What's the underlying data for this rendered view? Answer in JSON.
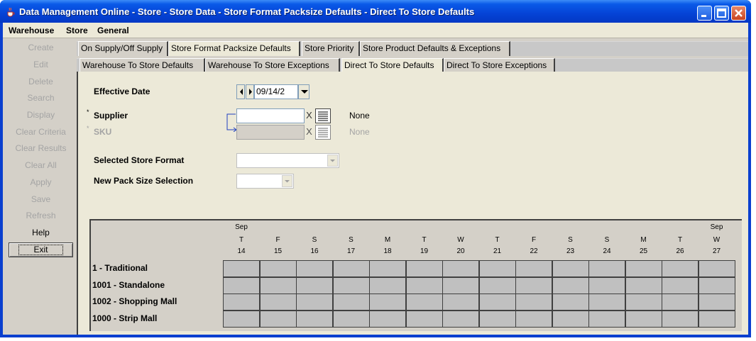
{
  "window": {
    "title": "Data Management Online - Store - Store Data - Store Format Packsize Defaults - Direct To Store Defaults",
    "icon": "java-cup-icon"
  },
  "menu": [
    "Warehouse",
    "Store",
    "General"
  ],
  "sidebar": [
    {
      "label": "Create",
      "enabled": false
    },
    {
      "label": "Edit",
      "enabled": false
    },
    {
      "label": "Delete",
      "enabled": false
    },
    {
      "label": "Search",
      "enabled": false
    },
    {
      "label": "Display",
      "enabled": false
    },
    {
      "label": "Clear Criteria",
      "enabled": false
    },
    {
      "label": "Clear Results",
      "enabled": false
    },
    {
      "label": "Clear All",
      "enabled": false
    },
    {
      "label": "Apply",
      "enabled": false
    },
    {
      "label": "Save",
      "enabled": false
    },
    {
      "label": "Refresh",
      "enabled": false
    },
    {
      "label": "Help",
      "enabled": true
    },
    {
      "label": "Exit",
      "enabled": true
    }
  ],
  "tabs_top": [
    {
      "label": "On Supply/Off Supply",
      "active": false
    },
    {
      "label": "Store Format Packsize Defaults",
      "active": true
    },
    {
      "label": "Store Priority",
      "active": false
    },
    {
      "label": "Store Product Defaults & Exceptions",
      "active": false
    }
  ],
  "tabs_sub": [
    {
      "label": "Warehouse To Store Defaults",
      "active": false
    },
    {
      "label": "Warehouse To Store Exceptions",
      "active": false
    },
    {
      "label": "Direct To Store Defaults",
      "active": true
    },
    {
      "label": "Direct To Store Exceptions",
      "active": false
    }
  ],
  "form": {
    "effective_date_label": "Effective Date",
    "effective_date_value": "09/14/2",
    "required_marker": "*",
    "supplier_label": "Supplier",
    "supplier_value": "",
    "supplier_description": "None",
    "sku_label": "SKU",
    "sku_value": "",
    "sku_description": "None",
    "clear_glyph": "X",
    "selected_store_format_label": "Selected Store Format",
    "selected_store_format_value": "",
    "new_pack_size_label": "New Pack Size Selection",
    "new_pack_size_value": ""
  },
  "grid": {
    "columns": [
      {
        "month": "Sep",
        "dow": "T",
        "day": "14"
      },
      {
        "month": "",
        "dow": "F",
        "day": "15"
      },
      {
        "month": "",
        "dow": "S",
        "day": "16"
      },
      {
        "month": "",
        "dow": "S",
        "day": "17"
      },
      {
        "month": "",
        "dow": "M",
        "day": "18"
      },
      {
        "month": "",
        "dow": "T",
        "day": "19"
      },
      {
        "month": "",
        "dow": "W",
        "day": "20"
      },
      {
        "month": "",
        "dow": "T",
        "day": "21"
      },
      {
        "month": "",
        "dow": "F",
        "day": "22"
      },
      {
        "month": "",
        "dow": "S",
        "day": "23"
      },
      {
        "month": "",
        "dow": "S",
        "day": "24"
      },
      {
        "month": "",
        "dow": "M",
        "day": "25"
      },
      {
        "month": "",
        "dow": "T",
        "day": "26"
      },
      {
        "month": "Sep",
        "dow": "W",
        "day": "27"
      }
    ],
    "rows": [
      "1 - Traditional",
      "1001 - Standalone",
      "1002 - Shopping Mall",
      "1000 - Strip Mall"
    ]
  },
  "colors": {
    "titlebar": "#0a5ae8",
    "disabled_text": "#a4a4a4",
    "grid_cell": "#c0c0c0"
  }
}
